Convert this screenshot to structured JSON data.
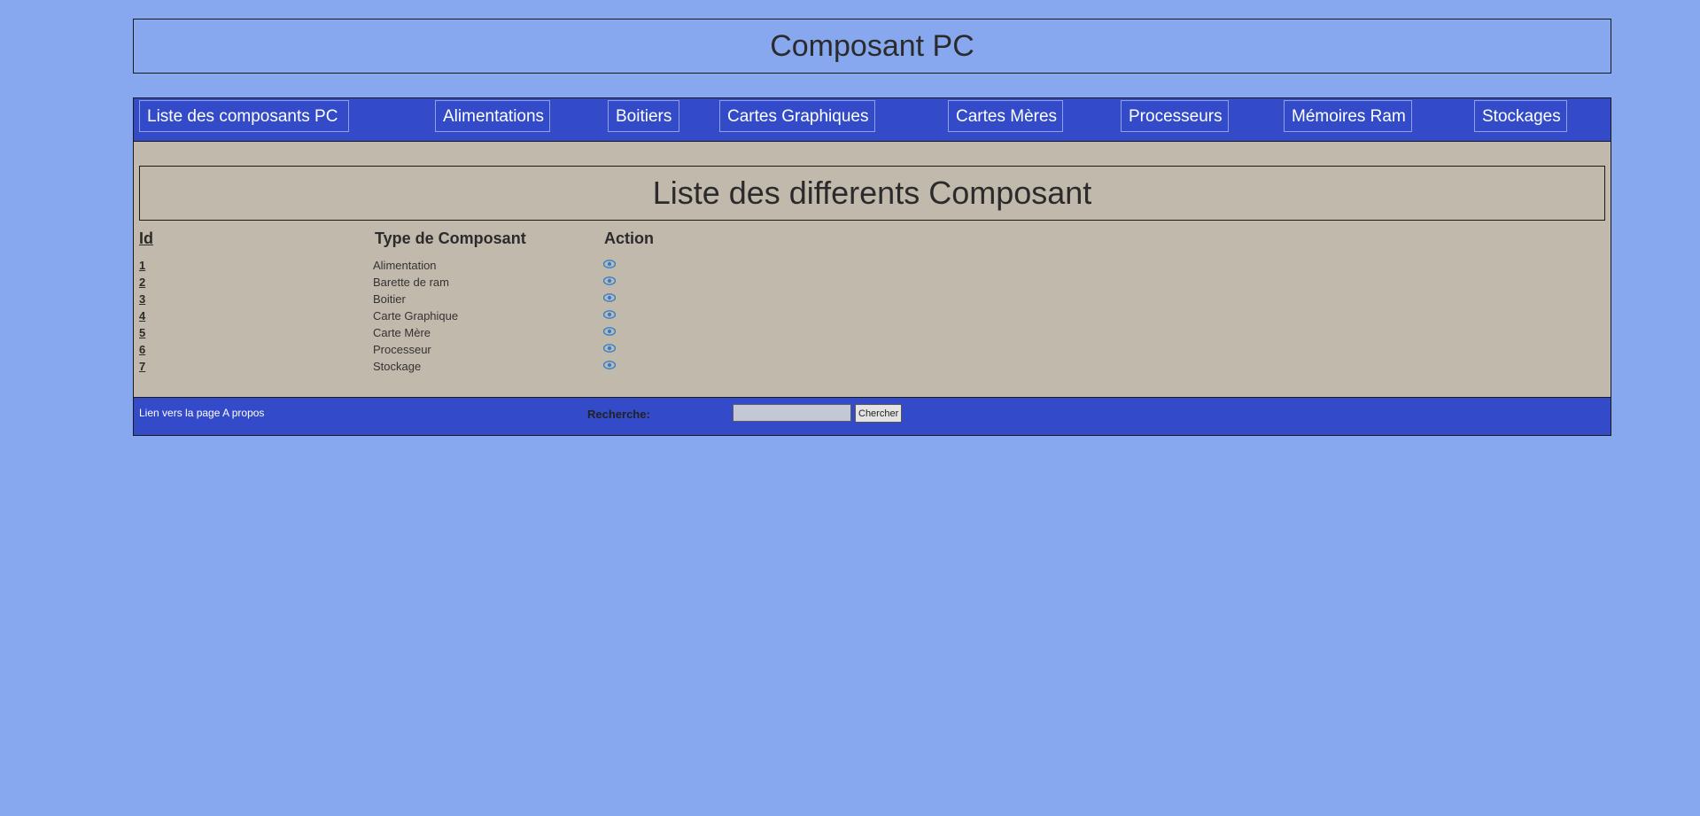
{
  "header": {
    "title": "Composant PC"
  },
  "nav": {
    "items": [
      {
        "label": "Liste des composants PC"
      },
      {
        "label": "Alimentations"
      },
      {
        "label": "Boitiers"
      },
      {
        "label": "Cartes Graphiques"
      },
      {
        "label": "Cartes Mères"
      },
      {
        "label": "Processeurs"
      },
      {
        "label": "Mémoires Ram"
      },
      {
        "label": "Stockages"
      }
    ]
  },
  "main": {
    "title": "Liste des differents Composant",
    "columns": [
      "Id",
      "Type de Composant",
      "Action"
    ],
    "rows": [
      {
        "id": "1",
        "type": "Alimentation",
        "action_icon": "eye-icon"
      },
      {
        "id": "2",
        "type": "Barette de ram",
        "action_icon": "eye-icon"
      },
      {
        "id": "3",
        "type": "Boitier",
        "action_icon": "eye-icon"
      },
      {
        "id": "4",
        "type": "Carte Graphique",
        "action_icon": "eye-icon"
      },
      {
        "id": "5",
        "type": "Carte Mère",
        "action_icon": "eye-icon"
      },
      {
        "id": "6",
        "type": "Processeur",
        "action_icon": "eye-icon"
      },
      {
        "id": "7",
        "type": "Stockage",
        "action_icon": "eye-icon"
      }
    ]
  },
  "footer": {
    "about_link": "Lien vers la page A propos",
    "search_label": "Recherche:",
    "search_value": "",
    "search_button": "Chercher"
  },
  "colors": {
    "page_background": "#87a8ef",
    "nav_background": "#334bc9",
    "content_background": "#c2b9ad",
    "icon_color": "#2f7fd1"
  }
}
